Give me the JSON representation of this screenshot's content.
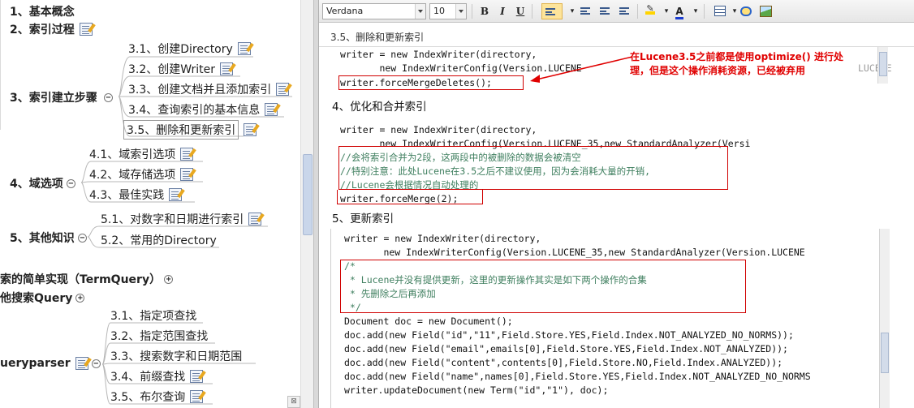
{
  "mindmap": {
    "nodes": [
      {
        "id": "n1",
        "label": "1、基本概念",
        "level": 1
      },
      {
        "id": "n2",
        "label": "2、索引过程",
        "level": 1
      },
      {
        "id": "n3",
        "label": "3、索引建立步骤",
        "level": 1
      },
      {
        "id": "n31",
        "label": "3.1、创建Directory"
      },
      {
        "id": "n32",
        "label": "3.2、创建Writer"
      },
      {
        "id": "n33",
        "label": "3.3、创建文档并且添加索引"
      },
      {
        "id": "n34",
        "label": "3.4、查询索引的基本信息"
      },
      {
        "id": "n35",
        "label": "3.5、删除和更新索引"
      },
      {
        "id": "n4",
        "label": "4、域选项",
        "level": 1
      },
      {
        "id": "n41",
        "label": "4.1、域索引选项"
      },
      {
        "id": "n42",
        "label": "4.2、域存储选项"
      },
      {
        "id": "n43",
        "label": "4.3、最佳实践"
      },
      {
        "id": "n5",
        "label": "5、其他知识",
        "level": 1
      },
      {
        "id": "n51",
        "label": "5.1、对数字和日期进行索引"
      },
      {
        "id": "n52",
        "label": "5.2、常用的Directory"
      },
      {
        "id": "p1",
        "label": "索的简单实现（TermQuery）"
      },
      {
        "id": "p2",
        "label": "他搜索Query"
      },
      {
        "id": "p3",
        "label": "ueryparser"
      },
      {
        "id": "q31",
        "label": "3.1、指定项查找"
      },
      {
        "id": "q32",
        "label": "3.2、指定范围查找"
      },
      {
        "id": "q33",
        "label": "3.3、搜索数字和日期范围"
      },
      {
        "id": "q34",
        "label": "3.4、前缀查找"
      },
      {
        "id": "q35",
        "label": "3.5、布尔查询"
      }
    ],
    "toggle_minus": "−",
    "toggle_plus": "+"
  },
  "toolbar": {
    "font_name": "Verdana",
    "font_size": "10",
    "bold": "B",
    "italic": "I",
    "underline": "U",
    "font_color_glyph": "A"
  },
  "editor": {
    "path": "3.5、删除和更新索引",
    "block1": {
      "line1": "writer = new IndexWriter(directory,",
      "line2": "       new IndexWriterConfig(Version.LUCENE",
      "line2_tail": "LUCENE",
      "line3": "writer.forceMergeDeletes();"
    },
    "annotation": {
      "line1": "在Lucene3.5之前都是使用optimize() 进行处",
      "line2": "理，但是这个操作消耗资源，已经被弃用"
    },
    "heading4": "4、优化和合并索引",
    "block2": {
      "line1": "writer = new IndexWriter(directory,",
      "line2": "       new IndexWriterConfig(Version.LUCENE_35,new StandardAnalyzer(Versi",
      "line3": "//会将索引合并为2段，这两段中的被删除的数据会被清空",
      "line4": "//特别注意：此处Lucene在3.5之后不建议使用，因为会消耗大量的开销,",
      "line5": "//Lucene会根据情况自动处理的",
      "line6": "writer.forceMerge(2);"
    },
    "heading5": "5、更新索引",
    "block3": {
      "line1": "writer = new IndexWriter(directory,",
      "line2": "       new IndexWriterConfig(Version.LUCENE_35,new StandardAnalyzer(Version.LUCENE",
      "line3": "/*",
      "line4": " * Lucene并没有提供更新，这里的更新操作其实是如下两个操作的合集",
      "line5": " * 先删除之后再添加",
      "line6": " */",
      "line7": "Document doc = new Document();",
      "line8": "doc.add(new Field(\"id\",\"11\",Field.Store.YES,Field.Index.NOT_ANALYZED_NO_NORMS));",
      "line9": "doc.add(new Field(\"email\",emails[0],Field.Store.YES,Field.Index.NOT_ANALYZED));",
      "line10": "doc.add(new Field(\"content\",contents[0],Field.Store.NO,Field.Index.ANALYZED));",
      "line11": "doc.add(new Field(\"name\",names[0],Field.Store.YES,Field.Index.NOT_ANALYZED_NO_NORMS",
      "line12": "writer.updateDocument(new Term(\"id\",\"1\"), doc);"
    }
  }
}
